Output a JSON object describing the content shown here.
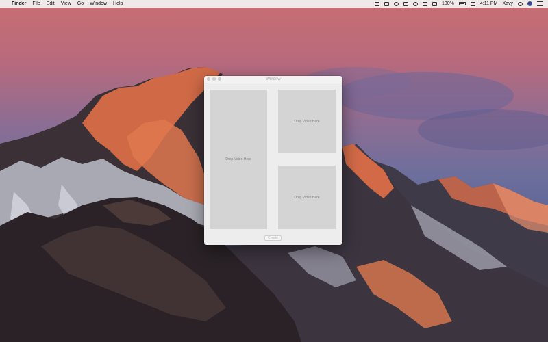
{
  "menubar": {
    "apple_glyph": "",
    "app_name": "Finder",
    "menus": [
      "File",
      "Edit",
      "View",
      "Go",
      "Window",
      "Help"
    ],
    "battery_percent": "100%",
    "time": "4:11 PM",
    "user": "Xavy"
  },
  "window": {
    "title": "Window",
    "drop_main": "Drop Video Here",
    "drop_top_right": "Drop Video Here",
    "drop_bottom_right": "Drop Video Here",
    "create_label": "Create"
  },
  "colors": {
    "sky_top": "#c86e72",
    "sky_mid": "#8f6d92",
    "mountain_dark": "#2f2b30",
    "mountain_glow": "#d8714b",
    "snow": "#d9dbe6",
    "drop_zone": "#d4d4d4",
    "window_bg": "#ededed"
  }
}
